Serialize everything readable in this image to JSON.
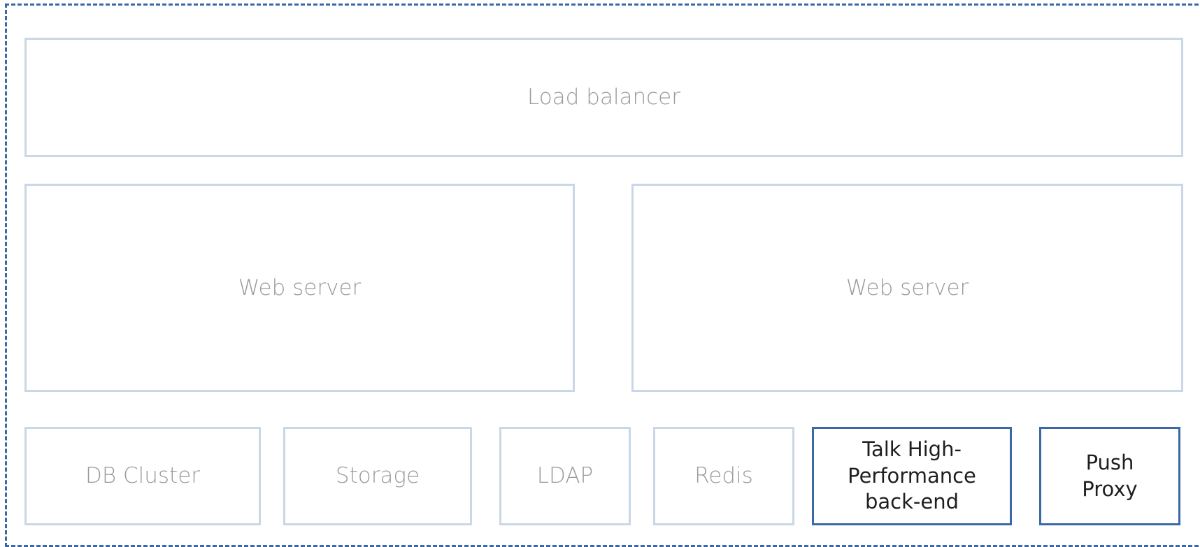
{
  "diagram": {
    "load_balancer": "Load balancer",
    "web_servers": [
      "Web server",
      "Web server"
    ],
    "services": {
      "db_cluster": "DB Cluster",
      "storage": "Storage",
      "ldap": "LDAP",
      "redis": "Redis",
      "talk_hpb": "Talk High-\nPerformance\nback-end",
      "push_proxy": "Push\nProxy"
    },
    "colors": {
      "frame_border": "#3a69a6",
      "box_border": "#c9d7e6",
      "highlight_border": "#3a69a6",
      "muted_text": "#9a9a9a",
      "highlight_text": "#1f1f1f"
    }
  }
}
